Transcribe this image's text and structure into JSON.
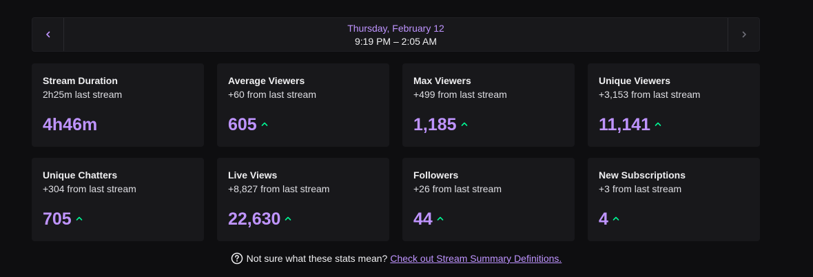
{
  "date_nav": {
    "day": "Thursday, February 12",
    "time_range": "9:19 PM – 2:05 AM",
    "prev_icon": "chevron-left-icon",
    "next_icon": "chevron-right-icon"
  },
  "colors": {
    "accent": "#bf94ff",
    "trend_up": "#00f593",
    "card_bg": "#18181b",
    "page_bg": "#0e0e10"
  },
  "stats": [
    {
      "title": "Stream Duration",
      "sub": "2h25m last stream",
      "value": "4h46m",
      "trend": "none"
    },
    {
      "title": "Average Viewers",
      "sub": "+60 from last stream",
      "value": "605",
      "trend": "up"
    },
    {
      "title": "Max Viewers",
      "sub": "+499 from last stream",
      "value": "1,185",
      "trend": "up"
    },
    {
      "title": "Unique Viewers",
      "sub": "+3,153 from last stream",
      "value": "11,141",
      "trend": "up"
    },
    {
      "title": "Unique Chatters",
      "sub": "+304 from last stream",
      "value": "705",
      "trend": "up"
    },
    {
      "title": "Live Views",
      "sub": "+8,827 from last stream",
      "value": "22,630",
      "trend": "up"
    },
    {
      "title": "Followers",
      "sub": "+26 from last stream",
      "value": "44",
      "trend": "up"
    },
    {
      "title": "New Subscriptions",
      "sub": "+3 from last stream",
      "value": "4",
      "trend": "up"
    }
  ],
  "footer": {
    "question": "Not sure what these stats mean?",
    "link_text": "Check out Stream Summary Definitions.",
    "icon": "help-circle-icon"
  }
}
